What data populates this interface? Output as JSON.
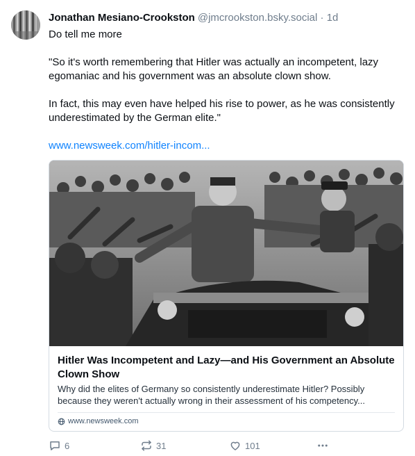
{
  "post": {
    "author": {
      "display_name": "Jonathan Mesiano-Crookston",
      "handle": "@jmcrookston.bsky.social",
      "separator": "·",
      "time": "1d"
    },
    "text": {
      "line1": "Do tell me more",
      "quote_part1": "\"So it's worth remembering that Hitler was actually an incompetent, lazy egomaniac and his government was an absolute clown show.",
      "quote_part2": "In fact, this may even have helped his rise to power, as he was consistently underestimated by the German elite.\"",
      "link": "www.newsweek.com/hitler-incom..."
    },
    "card": {
      "title": "Hitler Was Incompetent and Lazy—and His Government an Absolute Clown Show",
      "description": "Why did the elites of Germany so consistently underestimate Hitler? Possibly because they weren't actually wrong in their assessment of his competency...",
      "domain": "www.newsweek.com"
    },
    "actions": {
      "reply_count": "6",
      "repost_count": "31",
      "like_count": "101"
    }
  },
  "colors": {
    "link": "#1083fe",
    "muted": "#6f7d8c",
    "border": "#d4dbe2"
  }
}
